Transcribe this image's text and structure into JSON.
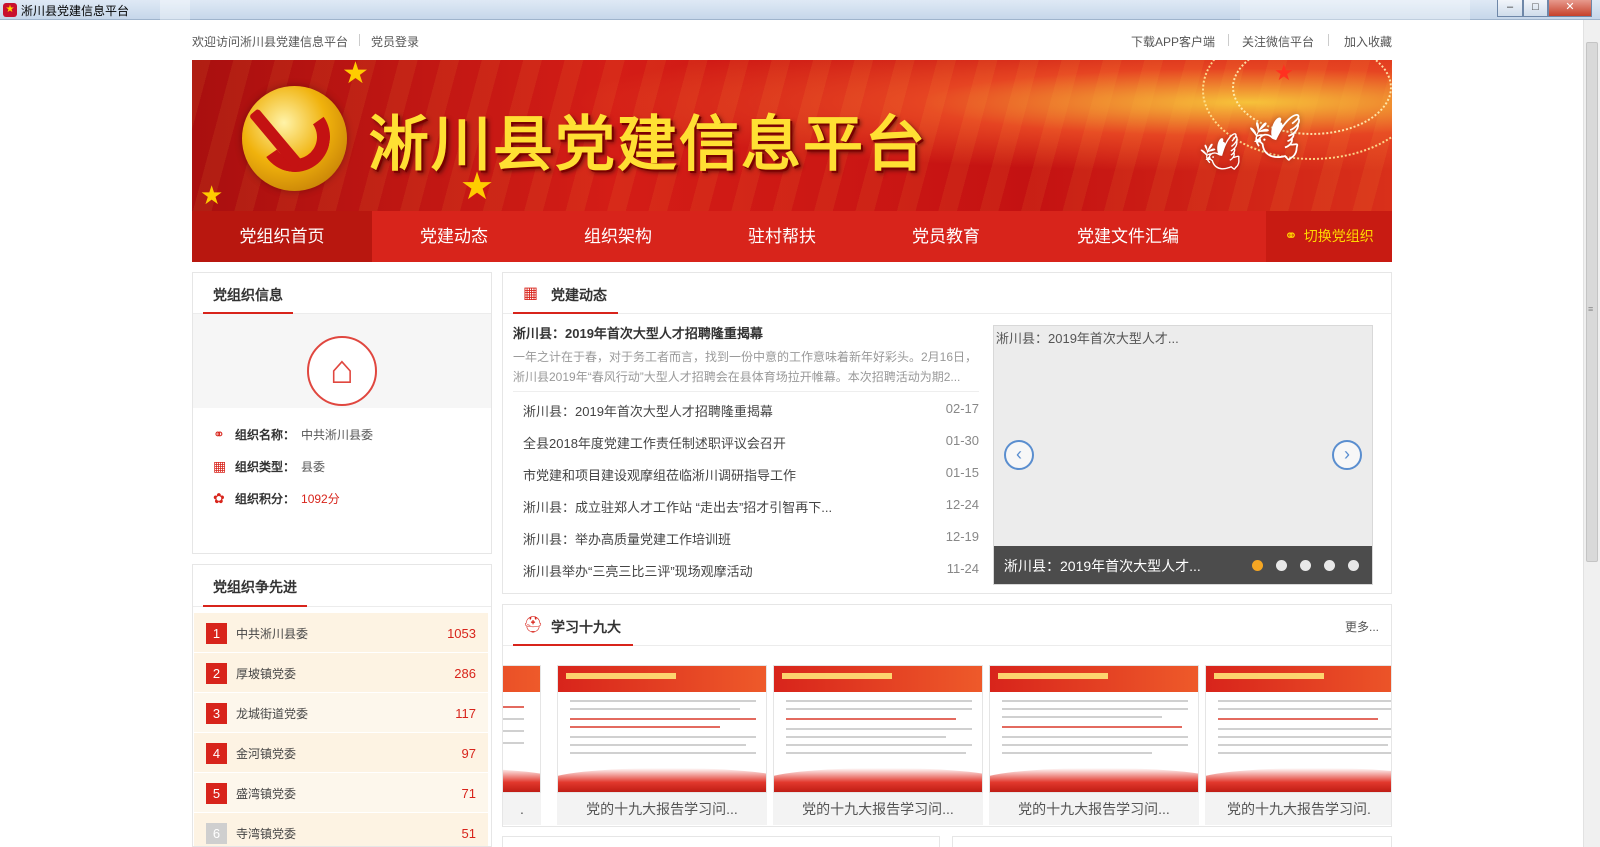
{
  "window": {
    "title": "淅川县党建信息平台",
    "controls": [
      "–",
      "□",
      "✕"
    ]
  },
  "topbar": {
    "welcome": "欢迎访问淅川县党建信息平台",
    "login": "党员登录",
    "download_app": "下载APP客户端",
    "follow_wechat": "关注微信平台",
    "add_favorite": "加入收藏"
  },
  "banner": {
    "headline": "淅川县党建信息平台"
  },
  "nav": {
    "items": [
      "党组织首页",
      "党建动态",
      "组织架构",
      "驻村帮扶",
      "党员教育",
      "党建文件汇编"
    ],
    "active_index": 0,
    "switch_label": "切换党组织",
    "switch_icon": "network-icon"
  },
  "org_info": {
    "title": "党组织信息",
    "rows": [
      {
        "icon": "network-icon",
        "label": "组织名称：",
        "value": "中共淅川县委"
      },
      {
        "icon": "grid-icon",
        "label": "组织类型：",
        "value": "县委"
      },
      {
        "icon": "ribbon-icon",
        "label": "组织积分：",
        "value": "1092分"
      }
    ]
  },
  "ranking": {
    "title": "党组织争先进",
    "items": [
      {
        "rank": "1",
        "name": "中共淅川县委",
        "score": "1053"
      },
      {
        "rank": "2",
        "name": "厚坡镇党委",
        "score": "286"
      },
      {
        "rank": "3",
        "name": "龙城街道党委",
        "score": "117"
      },
      {
        "rank": "4",
        "name": "金河镇党委",
        "score": "97"
      },
      {
        "rank": "5",
        "name": "盛湾镇党委",
        "score": "71"
      },
      {
        "rank": "6",
        "name": "寺湾镇党委",
        "score": "51"
      }
    ]
  },
  "news": {
    "title": "党建动态",
    "top_title": "淅川县：2019年首次大型人才招聘隆重揭幕",
    "top_summary": "一年之计在于春，对于务工者而言，找到一份中意的工作意味着新年好彩头。2月16日，淅川县2019年“春风行动”大型人才招聘会在县体育场拉开帷幕。本次招聘活动为期2...",
    "items": [
      {
        "title": "淅川县：2019年首次大型人才招聘隆重揭幕",
        "date": "02-17"
      },
      {
        "title": "全县2018年度党建工作责任制述职评议会召开",
        "date": "01-30"
      },
      {
        "title": "市党建和项目建设观摩组莅临淅川调研指导工作",
        "date": "01-15"
      },
      {
        "title": "淅川县：成立驻郑人才工作站 “走出去”招才引智再下...",
        "date": "12-24"
      },
      {
        "title": "淅川县：举办高质量党建工作培训班",
        "date": "12-19"
      },
      {
        "title": "淅川县举办“三亮三比三评”现场观摩活动",
        "date": "11-24"
      }
    ],
    "slider": {
      "top_caption": "淅川县：2019年首次大型人才...",
      "bottom_caption": "淅川县：2019年首次大型人才...",
      "dot_count": 5,
      "active_dot": 0,
      "prev_label": "‹",
      "next_label": "›"
    }
  },
  "study": {
    "title": "学习十九大",
    "more": "更多...",
    "cards": [
      {
        "label": "."
      },
      {
        "label": "党的十九大报告学习问..."
      },
      {
        "label": "党的十九大报告学习问..."
      },
      {
        "label": "党的十九大报告学习问..."
      },
      {
        "label": "党的十九大报告学习问."
      }
    ]
  },
  "colors": {
    "brand_red": "#d8241b",
    "nav_active": "#b8170f",
    "gold": "#ffd700",
    "dot_active": "#f5a623"
  }
}
